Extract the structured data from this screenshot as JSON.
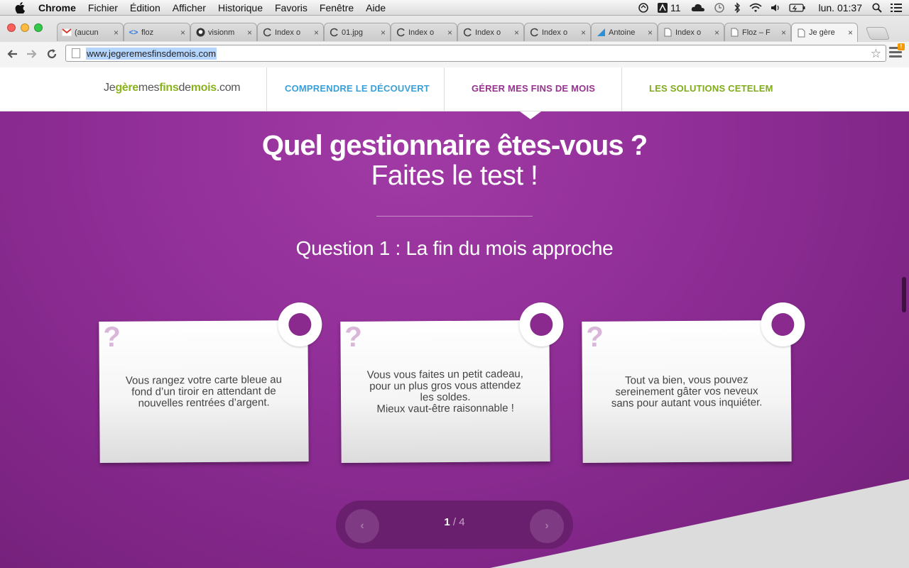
{
  "menubar": {
    "app": "Chrome",
    "items": [
      "Fichier",
      "Édition",
      "Afficher",
      "Historique",
      "Favoris",
      "Fenêtre",
      "Aide"
    ],
    "status": {
      "notifications": "11",
      "clock": "lun. 01:37"
    }
  },
  "browser": {
    "tabs": [
      {
        "title": "(aucun",
        "icon": "gmail-icon"
      },
      {
        "title": "floz",
        "icon": "code-icon"
      },
      {
        "title": "visionm",
        "icon": "github-icon"
      },
      {
        "title": "Index o",
        "icon": "loading-icon"
      },
      {
        "title": "01.jpg",
        "icon": "loading-icon"
      },
      {
        "title": "Index o",
        "icon": "loading-icon"
      },
      {
        "title": "Index o",
        "icon": "loading-icon"
      },
      {
        "title": "Index o",
        "icon": "loading-icon"
      },
      {
        "title": "Antoine",
        "icon": "site-icon"
      },
      {
        "title": "Index o",
        "icon": "page-icon"
      },
      {
        "title": "Floz – F",
        "icon": "page-icon"
      },
      {
        "title": "Je gère",
        "icon": "page-icon",
        "active": true
      }
    ],
    "url": "www.jegeremesfinsdemois.com"
  },
  "site": {
    "logo": {
      "a": "Je",
      "b": "gère",
      "c": "mes",
      "d": "fins",
      "e": "de",
      "f": "mois",
      "g": ".com"
    },
    "nav": [
      {
        "label": "COMPRENDRE LE DÉCOUVERT",
        "color": "#3aa0d8"
      },
      {
        "label": "GÉRER MES FINS DE MOIS",
        "color": "#96338f"
      },
      {
        "label": "LES SOLUTIONS CETELEM",
        "color": "#7fab1c"
      }
    ],
    "title": "Quel gestionnaire êtes-vous ?",
    "subtitle": "Faites le test !",
    "question": "Question 1 : La fin du mois approche",
    "cards": [
      {
        "mark": "?",
        "text": "Vous rangez votre carte bleue au\nfond d’un tiroir en attendant de\nnouvelles rentrées d’argent."
      },
      {
        "mark": "?",
        "text": "Vous vous faites un petit cadeau,\npour un plus gros vous attendez\nles soldes.\nMieux vaut-être raisonnable !"
      },
      {
        "mark": "?",
        "text": "Tout va bien, vous pouvez\nsereinement gâter vos neveux\nsans pour autant vous inquiéter."
      }
    ],
    "pager": {
      "current": "1",
      "separator": " / ",
      "total": "4",
      "prev": "‹",
      "next": "›"
    }
  },
  "colors": {
    "purple": "#8b2a8e",
    "green": "#8ab31c",
    "blue": "#3aa0d8"
  }
}
